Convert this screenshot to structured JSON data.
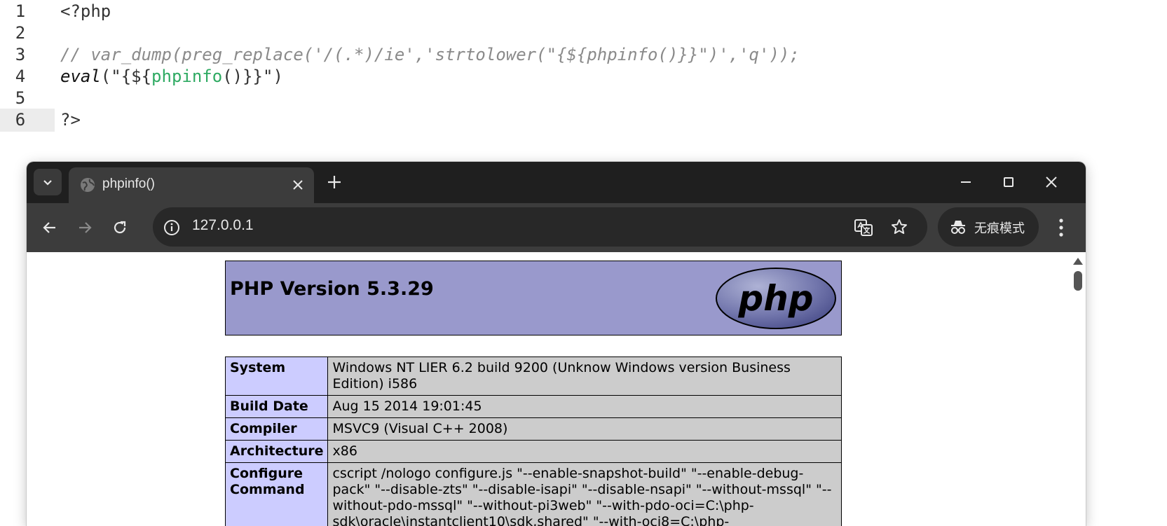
{
  "editor": {
    "lines": [
      {
        "num": "1",
        "text": "<?php"
      },
      {
        "num": "2",
        "text": ""
      },
      {
        "num": "3",
        "text": "// var_dump(preg_replace('/(.*)/ie','strtolower(\"{${phpinfo()}}\")','q'));"
      },
      {
        "num": "4",
        "eval": "eval",
        "pre": "(\"{${",
        "fn": "phpinfo",
        "post": "()}}\")"
      },
      {
        "num": "5",
        "text": ""
      },
      {
        "num": "6",
        "text": "?>"
      }
    ],
    "active_line": "6"
  },
  "browser": {
    "tab": {
      "title": "phpinfo()"
    },
    "url": "127.0.0.1",
    "incognito_label": "无痕模式",
    "icons": {
      "tab_list": "chevron-down-icon",
      "favicon": "globe-icon",
      "close_tab": "close-icon",
      "new_tab": "plus-icon",
      "back": "arrow-left-icon",
      "forward": "arrow-right-icon",
      "reload": "reload-icon",
      "site_info": "info-icon",
      "translate": "translate-icon",
      "bookmark": "star-icon",
      "incognito": "incognito-icon",
      "menu": "kebab-menu-icon"
    }
  },
  "phpinfo": {
    "version_title": "PHP Version 5.3.29",
    "logo_text": "php",
    "rows": [
      {
        "key": "System",
        "value": "Windows NT LIER 6.2 build 9200 (Unknow Windows version Business Edition) i586"
      },
      {
        "key": "Build Date",
        "value": "Aug 15 2014 19:01:45"
      },
      {
        "key": "Compiler",
        "value": "MSVC9 (Visual C++ 2008)"
      },
      {
        "key": "Architecture",
        "value": "x86"
      },
      {
        "key": "Configure Command",
        "value": "cscript /nologo configure.js \"--enable-snapshot-build\" \"--enable-debug-pack\" \"--disable-zts\" \"--disable-isapi\" \"--disable-nsapi\" \"--without-mssql\" \"--without-pdo-mssql\" \"--without-pi3web\" \"--with-pdo-oci=C:\\php-sdk\\oracle\\instantclient10\\sdk,shared\" \"--with-oci8=C:\\php-"
      }
    ]
  },
  "colors": {
    "php_header": "#9999cc",
    "key_cell": "#ccccff",
    "value_cell": "#cccccc",
    "titlebar": "#1f1f1f",
    "toolbar": "#3c3c3c"
  }
}
